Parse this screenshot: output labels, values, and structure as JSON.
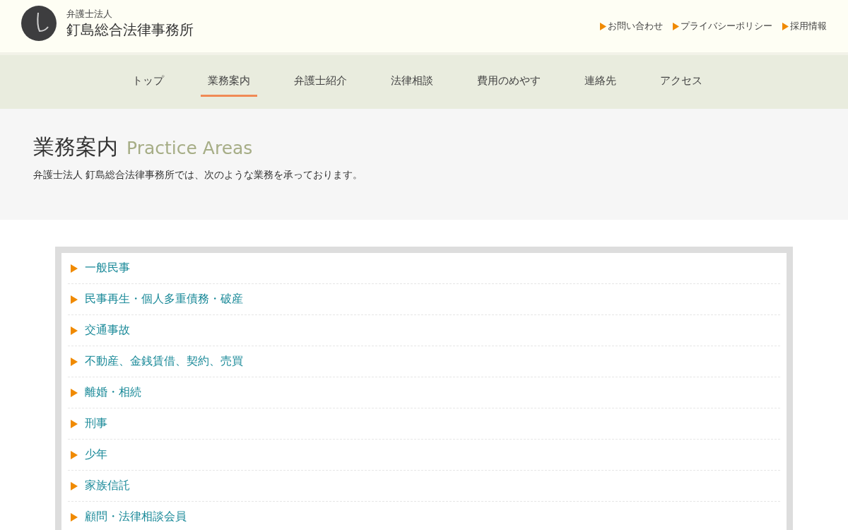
{
  "header": {
    "firm_type": "弁護士法人",
    "firm_name": "釘島総合法律事務所",
    "links": [
      {
        "label": "お問い合わせ"
      },
      {
        "label": "プライバシーポリシー"
      },
      {
        "label": "採用情報"
      }
    ]
  },
  "nav": [
    {
      "label": "トップ",
      "selected": false
    },
    {
      "label": "業務案内",
      "selected": true
    },
    {
      "label": "弁護士紹介",
      "selected": false
    },
    {
      "label": "法律相談",
      "selected": false
    },
    {
      "label": "費用のめやす",
      "selected": false
    },
    {
      "label": "連絡先",
      "selected": false
    },
    {
      "label": "アクセス",
      "selected": false
    }
  ],
  "page": {
    "title": "業務案内",
    "subtitle": "Practice Areas",
    "intro": "弁護士法人 釘島総合法律事務所では、次のような業務を承っております。"
  },
  "practice_areas": [
    {
      "label": "一般民事"
    },
    {
      "label": "民事再生・個人多重債務・破産"
    },
    {
      "label": "交通事故"
    },
    {
      "label": "不動産、金銭賃借、契約、売買"
    },
    {
      "label": "離婚・相続"
    },
    {
      "label": "刑事"
    },
    {
      "label": "少年"
    },
    {
      "label": "家族信託"
    },
    {
      "label": "顧問・法律相談会員"
    }
  ]
}
